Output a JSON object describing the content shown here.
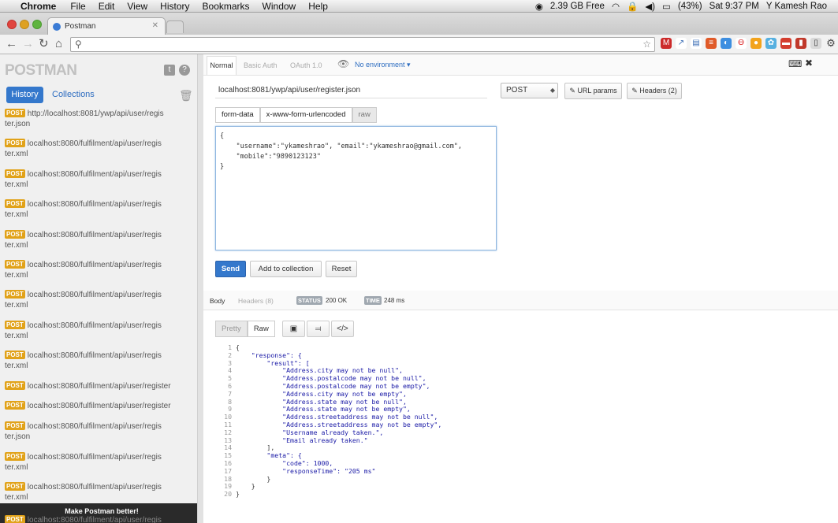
{
  "menubar": {
    "app": "Chrome",
    "items": [
      "File",
      "Edit",
      "View",
      "History",
      "Bookmarks",
      "Window",
      "Help"
    ],
    "memory": "2.39 GB Free",
    "battery": "(43%)",
    "clock": "Sat 9:37 PM",
    "user": "Y Kamesh Rao"
  },
  "browser": {
    "tab_title": "Postman",
    "address": ""
  },
  "sidebar": {
    "logo": "POSTMAN",
    "history_tab": "History",
    "collections_tab": "Collections",
    "method_badge": "POST",
    "history": [
      {
        "l1": "http://localhost:8081/ywp/api/user/regis",
        "l2": "ter.json"
      },
      {
        "l1": "localhost:8080/fulfilment/api/user/regis",
        "l2": "ter.xml"
      },
      {
        "l1": "localhost:8080/fulfilment/api/user/regis",
        "l2": "ter.xml"
      },
      {
        "l1": "localhost:8080/fulfilment/api/user/regis",
        "l2": "ter.xml"
      },
      {
        "l1": "localhost:8080/fulfilment/api/user/regis",
        "l2": "ter.xml"
      },
      {
        "l1": "localhost:8080/fulfilment/api/user/regis",
        "l2": "ter.xml"
      },
      {
        "l1": "localhost:8080/fulfilment/api/user/regis",
        "l2": "ter.xml"
      },
      {
        "l1": "localhost:8080/fulfilment/api/user/regis",
        "l2": "ter.xml"
      },
      {
        "l1": "localhost:8080/fulfilment/api/user/regis",
        "l2": "ter.xml"
      },
      {
        "l1": "localhost:8080/fulfilment/api/user/register",
        "l2": ""
      },
      {
        "l1": "localhost:8080/fulfilment/api/user/register",
        "l2": ""
      },
      {
        "l1": "localhost:8080/fulfilment/api/user/regis",
        "l2": "ter.json"
      },
      {
        "l1": "localhost:8080/fulfilment/api/user/regis",
        "l2": "ter.xml"
      },
      {
        "l1": "localhost:8080/fulfilment/api/user/regis",
        "l2": "ter.xml"
      }
    ],
    "toast": "Make Postman better!",
    "toast_under": "localhost:8080/fulfilment/api/user/regis"
  },
  "request": {
    "modes": [
      "Normal",
      "Basic Auth",
      "OAuth 1.0"
    ],
    "environment": "No environment",
    "url": "localhost:8081/ywp/api/user/register.json",
    "method": "POST",
    "url_params": "URL params",
    "headers": "Headers (2)",
    "body_tabs": [
      "form-data",
      "x-www-form-urlencoded",
      "raw"
    ],
    "raw_body": "{\n    \"username\":\"ykameshrao\", \"email\":\"ykameshrao@gmail.com\",\n    \"mobile\":\"9890123123\"\n}",
    "send": "Send",
    "add_to_collection": "Add to collection",
    "reset": "Reset"
  },
  "response": {
    "tabs": [
      "Body",
      "Headers (8)"
    ],
    "status_label": "STATUS",
    "status": "200 OK",
    "time_label": "TIME",
    "time": "248 ms",
    "view_tabs": [
      "Pretty",
      "Raw"
    ],
    "code_lines": [
      "{",
      "    \"response\": {",
      "        \"result\": [",
      "            \"Address.city may not be null\",",
      "            \"Address.postalcode may not be null\",",
      "            \"Address.postalcode may not be empty\",",
      "            \"Address.city may not be empty\",",
      "            \"Address.state may not be null\",",
      "            \"Address.state may not be empty\",",
      "            \"Address.streetaddress may not be null\",",
      "            \"Address.streetaddress may not be empty\",",
      "            \"Username already taken.\",",
      "            \"Email already taken.\"",
      "        ],",
      "        \"meta\": {",
      "            \"code\": 1000,",
      "            \"responseTime\": \"205 ms\"",
      "        }",
      "    }",
      "}"
    ]
  }
}
